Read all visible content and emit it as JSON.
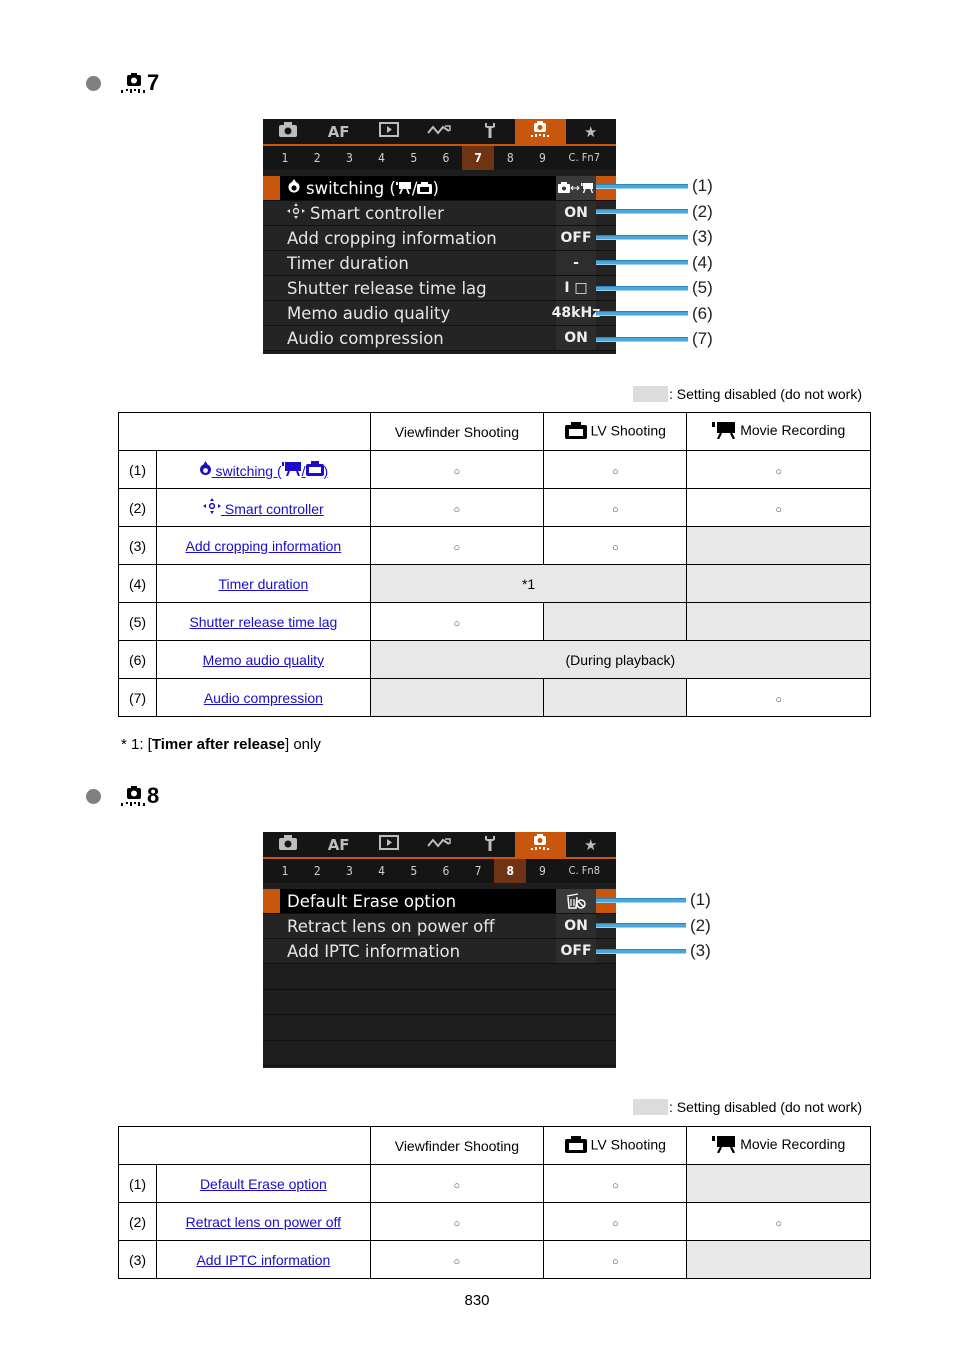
{
  "sections": [
    {
      "number": "7",
      "icon": "custom-functions-icon",
      "screen": {
        "tabs": [
          {
            "icon": "camera-icon",
            "label": ""
          },
          {
            "icon": "",
            "label": "AF"
          },
          {
            "icon": "playback-icon",
            "label": ""
          },
          {
            "icon": "wireless-icon",
            "label": ""
          },
          {
            "icon": "wrench-icon",
            "label": ""
          },
          {
            "icon": "custom-functions-icon",
            "label": "",
            "active": true
          },
          {
            "icon": "star-icon",
            "label": ""
          }
        ],
        "subtabs": [
          "1",
          "2",
          "3",
          "4",
          "5",
          "6",
          "7",
          "8",
          "9",
          "C. Fn7"
        ],
        "active_subtab": "7",
        "items": [
          {
            "label": "switching (’■/■)",
            "icon": "mode-dial-icon",
            "value": "■↔■",
            "value_icon": "still-movie-switch-icon",
            "selected": true
          },
          {
            "label": "Smart controller",
            "icon": "smart-controller-icon",
            "value": "ON"
          },
          {
            "label": "Add cropping information",
            "value": "OFF"
          },
          {
            "label": "Timer duration",
            "value": "-"
          },
          {
            "label": "Shutter release time lag",
            "value": "I □"
          },
          {
            "label": "Memo audio quality",
            "value": "48kHz"
          },
          {
            "label": "Audio compression",
            "value": "ON"
          }
        ],
        "callouts": [
          "(1)",
          "(2)",
          "(3)",
          "(4)",
          "(5)",
          "(6)",
          "(7)"
        ]
      },
      "legend": ": Setting disabled (do not work)",
      "table": {
        "headers": [
          "",
          "Viewfinder Shooting",
          "LV Shooting",
          "Movie Recording"
        ],
        "rows": [
          {
            "num": "(1)",
            "name": "switching (",
            "name_suffix": ")",
            "vf": "○",
            "lv": "○",
            "movie": "○"
          },
          {
            "num": "(2)",
            "name": "Smart controller",
            "vf": "○",
            "lv": "○",
            "movie": "○"
          },
          {
            "num": "(3)",
            "name": "Add cropping information",
            "vf": "○",
            "lv": "○",
            "movie": ""
          },
          {
            "num": "(4)",
            "name": "Timer duration",
            "vf_lv": "*1",
            "movie": ""
          },
          {
            "num": "(5)",
            "name": "Shutter release time lag",
            "vf": "○",
            "lv": "",
            "movie": ""
          },
          {
            "num": "(6)",
            "name": "Memo audio quality",
            "all": "(During playback)"
          },
          {
            "num": "(7)",
            "name": "Audio compression",
            "vf": "",
            "lv": "",
            "movie": "○"
          }
        ]
      },
      "footnote": {
        "prefix": "* 1: [",
        "bold": "Timer after release",
        "suffix": "] only"
      }
    },
    {
      "number": "8",
      "icon": "custom-functions-icon",
      "screen": {
        "subtabs": [
          "1",
          "2",
          "3",
          "4",
          "5",
          "6",
          "7",
          "8",
          "9",
          "C. Fn8"
        ],
        "active_subtab": "8",
        "items": [
          {
            "label": "Default Erase option",
            "value": "",
            "value_icon": "erase-cancel-icon",
            "selected": true
          },
          {
            "label": "Retract lens on power off",
            "value": "ON"
          },
          {
            "label": "Add IPTC information",
            "value": "OFF"
          },
          {
            "label": "",
            "value": ""
          },
          {
            "label": "",
            "value": ""
          },
          {
            "label": "",
            "value": ""
          },
          {
            "label": "",
            "value": ""
          }
        ],
        "callouts": [
          "(1)",
          "(2)",
          "(3)"
        ]
      },
      "legend": ": Setting disabled (do not work)",
      "table": {
        "headers": [
          "",
          "Viewfinder Shooting",
          "LV Shooting",
          "Movie Recording"
        ],
        "rows": [
          {
            "num": "(1)",
            "name": "Default Erase option",
            "vf": "○",
            "lv": "○",
            "movie": ""
          },
          {
            "num": "(2)",
            "name": "Retract lens on power off",
            "vf": "○",
            "lv": "○",
            "movie": "○"
          },
          {
            "num": "(3)",
            "name": "Add IPTC information",
            "vf": "○",
            "lv": "○",
            "movie": ""
          }
        ]
      }
    }
  ],
  "tab_af_label": "AF",
  "page_number": "830"
}
